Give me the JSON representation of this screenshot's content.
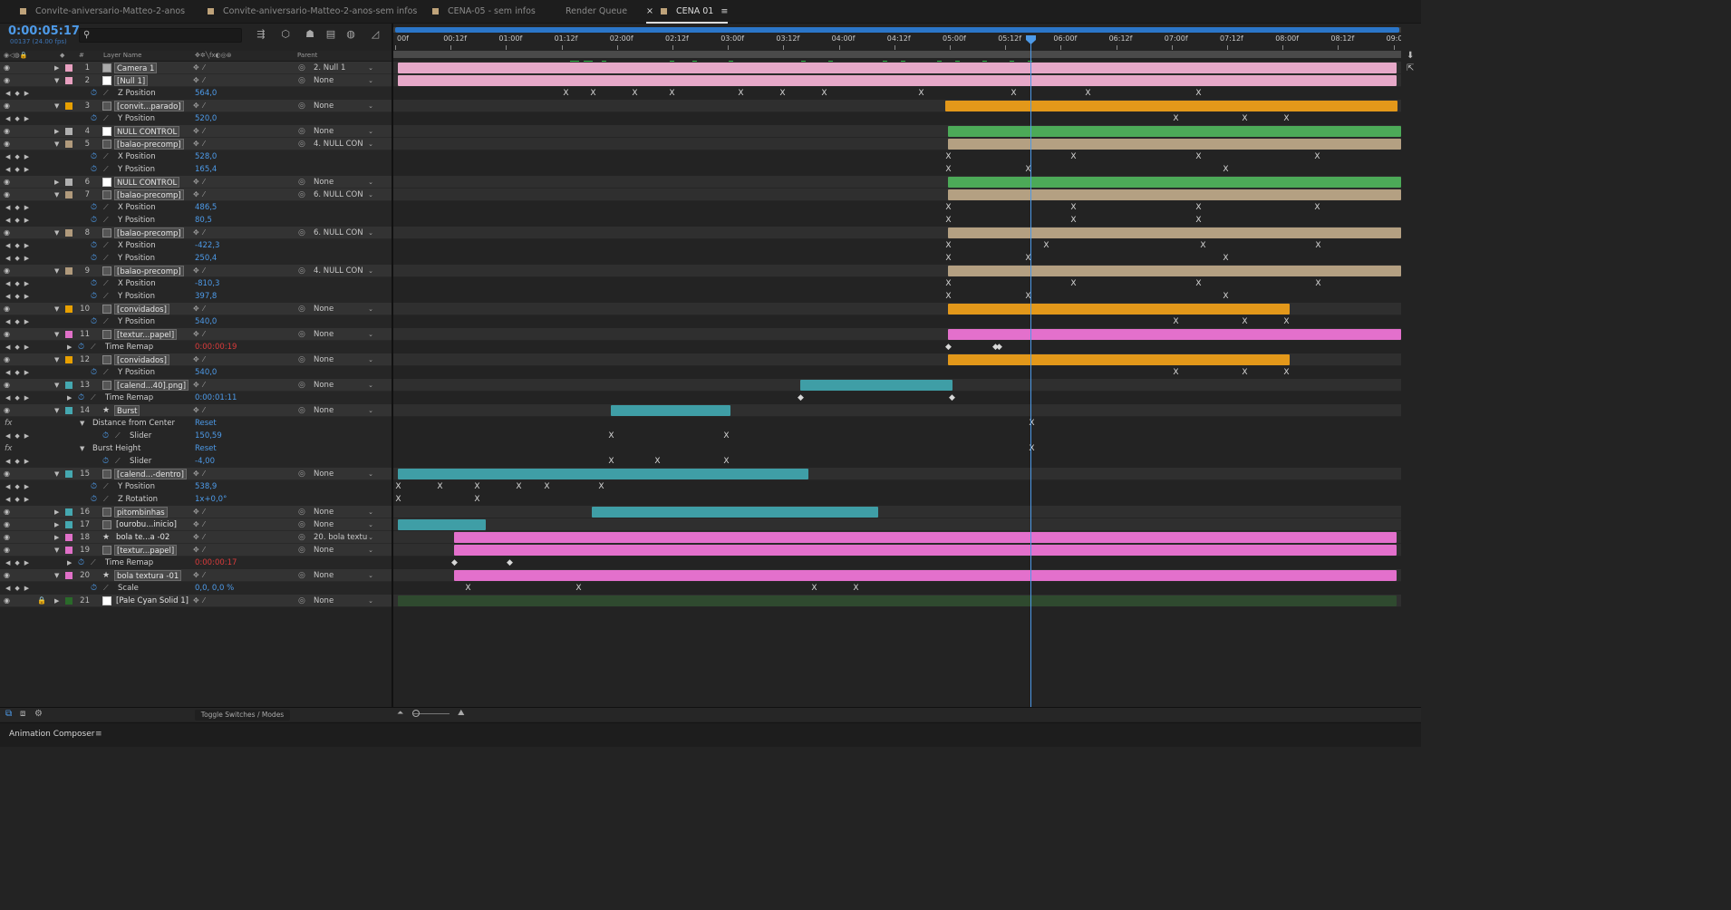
{
  "tabs": [
    {
      "label": "Convite-aniversario-Matteo-2-anos",
      "color": "#bfa37a"
    },
    {
      "label": "Convite-aniversario-Matteo-2-anos-sem infos",
      "color": "#bfa37a"
    },
    {
      "label": "CENA-05 - sem infos",
      "color": "#bfa37a"
    },
    {
      "label": "Render Queue",
      "color": ""
    },
    {
      "label": "CENA 01",
      "color": "#bfa37a",
      "active": true
    }
  ],
  "header": {
    "timecode": "0:00:05:17",
    "frames": "00137 (24.00 fps)",
    "search_placeholder": ""
  },
  "columns": {
    "layer_name": "Layer Name",
    "parent": "Parent",
    "hash": "#"
  },
  "time_ruler": [
    "00f",
    "00:12f",
    "01:00f",
    "01:12f",
    "02:00f",
    "02:12f",
    "03:00f",
    "03:12f",
    "04:00f",
    "04:12f",
    "05:00f",
    "05:12f",
    "06:00f",
    "06:12f",
    "07:00f",
    "07:12f",
    "08:00f",
    "08:12f",
    "09:0"
  ],
  "layers": [
    {
      "num": "1",
      "name": "Camera 1",
      "color": "#e8a0c0",
      "type": "cam",
      "parent": "2. Null 1",
      "boxed": true
    },
    {
      "num": "2",
      "name": "[Null 1]",
      "color": "#e8a0c0",
      "type": "solid",
      "parent": "None",
      "boxed": true,
      "open": true
    },
    {
      "prop": "Z Position",
      "value": "564,0"
    },
    {
      "num": "3",
      "name": "[convit...parado]",
      "color": "#e8a000",
      "type": "comp",
      "parent": "None",
      "boxed": true,
      "open": true
    },
    {
      "prop": "Y Position",
      "value": "520,0"
    },
    {
      "num": "4",
      "name": "NULL CONTROL",
      "color": "#b0b0b0",
      "type": "solid",
      "parent": "None",
      "boxed": true
    },
    {
      "num": "5",
      "name": "[balao-precomp]",
      "color": "#b09a7c",
      "type": "comp",
      "parent": "4. NULL CON",
      "boxed": true,
      "open": true
    },
    {
      "prop": "X Position",
      "value": "528,0"
    },
    {
      "prop": "Y Position",
      "value": "165,4"
    },
    {
      "num": "6",
      "name": "NULL CONTROL",
      "color": "#b0b0b0",
      "type": "solid",
      "parent": "None",
      "boxed": true
    },
    {
      "num": "7",
      "name": "[balao-precomp]",
      "color": "#b09a7c",
      "type": "comp",
      "parent": "6. NULL CON",
      "boxed": true,
      "open": true
    },
    {
      "prop": "X Position",
      "value": "486,5"
    },
    {
      "prop": "Y Position",
      "value": "80,5"
    },
    {
      "num": "8",
      "name": "[balao-precomp]",
      "color": "#b09a7c",
      "type": "comp",
      "parent": "6. NULL CON",
      "boxed": true,
      "open": true
    },
    {
      "prop": "X Position",
      "value": "-422,3"
    },
    {
      "prop": "Y Position",
      "value": "250,4"
    },
    {
      "num": "9",
      "name": "[balao-precomp]",
      "color": "#b09a7c",
      "type": "comp",
      "parent": "4. NULL CON",
      "boxed": true,
      "open": true
    },
    {
      "prop": "X Position",
      "value": "-810,3"
    },
    {
      "prop": "Y Position",
      "value": "397,8"
    },
    {
      "num": "10",
      "name": "[convidados]",
      "color": "#e8a000",
      "type": "comp",
      "parent": "None",
      "boxed": true,
      "open": true
    },
    {
      "prop": "Y Position",
      "value": "540,0"
    },
    {
      "num": "11",
      "name": "[textur...papel]",
      "color": "#e070c8",
      "type": "comp",
      "parent": "None",
      "boxed": true,
      "open": true
    },
    {
      "prop": "Time Remap",
      "value": "0:00:00:19",
      "red": true
    },
    {
      "num": "12",
      "name": "[convidados]",
      "color": "#e8a000",
      "type": "comp",
      "parent": "None",
      "boxed": true,
      "open": true
    },
    {
      "prop": "Y Position",
      "value": "540,0"
    },
    {
      "num": "13",
      "name": "[calend...40].png]",
      "color": "#45a8b0",
      "type": "comp",
      "parent": "None",
      "boxed": true,
      "open": true
    },
    {
      "prop": "Time Remap",
      "value": "0:00:01:11"
    },
    {
      "num": "14",
      "name": "Burst",
      "color": "#45a8b0",
      "type": "star",
      "parent": "None",
      "boxed": true,
      "open": true
    },
    {
      "fx": "Distance from Center",
      "value": "Reset"
    },
    {
      "prop": "Slider",
      "value": "150,59"
    },
    {
      "fx": "Burst Height",
      "value": "Reset"
    },
    {
      "prop": "Slider",
      "value": "-4,00"
    },
    {
      "num": "15",
      "name": "[calend...-dentro]",
      "color": "#45a8b0",
      "type": "comp",
      "parent": "None",
      "boxed": true,
      "open": true
    },
    {
      "prop": "Y Position",
      "value": "538,9"
    },
    {
      "prop": "Z Rotation",
      "value": "1x+0,0°"
    },
    {
      "num": "16",
      "name": "pitombinhas",
      "color": "#45a8b0",
      "type": "comp",
      "parent": "None",
      "boxed": true
    },
    {
      "num": "17",
      "name": "[ourobu...inicio]",
      "color": "#45a8b0",
      "type": "comp",
      "parent": "None",
      "boxed": false
    },
    {
      "num": "18",
      "name": "bola te...a -02",
      "color": "#e070c8",
      "type": "star",
      "parent": "20. bola textu",
      "boxed": false
    },
    {
      "num": "19",
      "name": "[textur...papel]",
      "color": "#e070c8",
      "type": "comp",
      "parent": "None",
      "boxed": true,
      "open": true
    },
    {
      "prop": "Time Remap",
      "value": "0:00:00:17",
      "red": true
    },
    {
      "num": "20",
      "name": "bola textura -01",
      "color": "#e070c8",
      "type": "star",
      "parent": "None",
      "boxed": true,
      "open": true
    },
    {
      "prop": "Scale",
      "value": "0,0, 0,0 %"
    },
    {
      "num": "21",
      "name": "[Pale Cyan Solid 1]",
      "color": "#2a6a2a",
      "type": "solid",
      "parent": "None",
      "boxed": false,
      "locked": true
    }
  ],
  "bottom": {
    "toggle": "Toggle Switches / Modes",
    "panel": "Animation Composer"
  }
}
